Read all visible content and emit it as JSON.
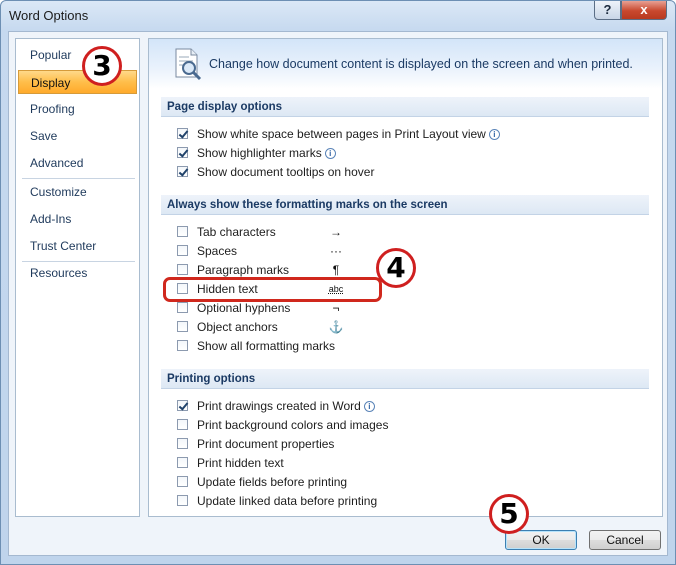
{
  "window": {
    "title": "Word Options",
    "help_label": "?",
    "close_label": "x"
  },
  "sidebar": {
    "items": [
      {
        "label": "Popular"
      },
      {
        "label": "Display"
      },
      {
        "label": "Proofing"
      },
      {
        "label": "Save"
      },
      {
        "label": "Advanced"
      },
      {
        "label": "Customize"
      },
      {
        "label": "Add-Ins"
      },
      {
        "label": "Trust Center"
      },
      {
        "label": "Resources"
      }
    ],
    "active": "Display"
  },
  "main": {
    "banner": "Change how document content is displayed on the screen and when printed.",
    "sections": [
      {
        "title": "Page display options",
        "options": [
          {
            "label": "Show white space between pages in Print Layout view",
            "checked": true,
            "info": true
          },
          {
            "label": "Show highlighter marks",
            "checked": true,
            "info": true
          },
          {
            "label": "Show document tooltips on hover",
            "checked": true,
            "info": false
          }
        ]
      },
      {
        "title": "Always show these formatting marks on the screen",
        "options": [
          {
            "label": "Tab characters",
            "checked": false,
            "symbol": "→"
          },
          {
            "label": "Spaces",
            "checked": false,
            "symbol": "···"
          },
          {
            "label": "Paragraph marks",
            "checked": false,
            "symbol": "¶"
          },
          {
            "label": "Hidden text",
            "checked": false,
            "symbol": "abc"
          },
          {
            "label": "Optional hyphens",
            "checked": false,
            "symbol": "¬"
          },
          {
            "label": "Object anchors",
            "checked": false,
            "symbol": "⚓"
          },
          {
            "label": "Show all formatting marks",
            "checked": false
          }
        ]
      },
      {
        "title": "Printing options",
        "options": [
          {
            "label": "Print drawings created in Word",
            "checked": true,
            "info": true
          },
          {
            "label": "Print background colors and images",
            "checked": false
          },
          {
            "label": "Print document properties",
            "checked": false
          },
          {
            "label": "Print hidden text",
            "checked": false
          },
          {
            "label": "Update fields before printing",
            "checked": false
          },
          {
            "label": "Update linked data before printing",
            "checked": false
          }
        ]
      }
    ]
  },
  "footer": {
    "ok_label": "OK",
    "cancel_label": "Cancel"
  },
  "callouts": {
    "step3": "3",
    "step4": "4",
    "step5": "5"
  },
  "icons": {
    "info": "i"
  },
  "colors": {
    "callout_red": "#cf1f1f",
    "active_tab": "#ffbe4a"
  }
}
